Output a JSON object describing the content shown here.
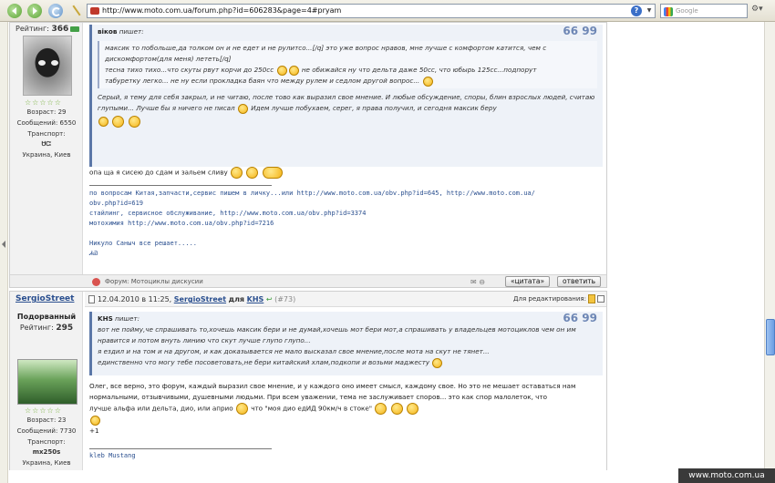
{
  "browser": {
    "url": "http://www.moto.com.ua/forum.php?id=606283&page=4#pryam",
    "search_placeholder": "Google"
  },
  "post1": {
    "side": {
      "rating_label": "Рейтинг:",
      "rating_value": "366",
      "stars": "☆☆☆☆☆",
      "age": "Возраст: 29",
      "messages": "Сообщений: 6550",
      "transport_label": "Транспорт:",
      "transport_value": "ᏌᏨ",
      "location": "Украина, Киев"
    },
    "quote": {
      "author": "вiков",
      "says": "пишет:",
      "inner": "максик то побольше,да толком он и не едет и не рулитсо...[/q] это уже вопрос нравов, мне лучше с комфортом катится, чем с дискомфортом(для меня) лететь[/q]",
      "line2": "тесна тихо тихо...что скуты рвут корчи до 250сс",
      "line2b": "не обижайся ну что дельта даже 50сс, что юбырь 125сс...подпорут",
      "line3": "табуретку легко... не ну если прокладка баян что между рулем и седлом другой вопрос...",
      "line4": "Серый, я тему для себя закрыл, и не читаю, после тово как выразил свое мнение. И любые обсуждение, споры, блин взрослых людей, считаю глупыми... Лучше бы я ничего не писал",
      "line4b": "Идем лучше побухаем, серег, я права получил, и сегодня максик беру"
    },
    "text1": "опа ща я сисею до сдам и зальем сливу",
    "signature": {
      "line1": "по вопросам Китая,запчасти,сервис пишем в личку...или http://www.moto.com.ua/obv.php?id=645, http://www.moto.com.ua/",
      "line2": "obv.php?id=619",
      "line3": "стайлинг, сервисное обслуживание, http://www.moto.com.ua/obv.php?id=3374",
      "line4": "мотохимия http://www.moto.com.ua/obv.php?id=7216",
      "line5": "Никуло Саныч все решает.....",
      "line6": "ᏗᏯ"
    },
    "footer": {
      "forum": "Форум: Мотоциклы дискусии",
      "quote_button": "«цитата»",
      "reply_button": "ответить"
    }
  },
  "post2": {
    "side": {
      "username": "SergioStreet",
      "rank": "Подорванный",
      "rating_label": "Рейтинг:",
      "rating_value": "295",
      "stars": "☆☆☆☆☆",
      "age": "Возраст: 23",
      "messages": "Сообщений: 7730",
      "transport_label": "Транспорт:",
      "transport_value": "mx250s",
      "location": "Украина, Киев"
    },
    "header": {
      "date": "12.04.2010 в 11:25,",
      "author": "SergioStreet",
      "for_word": "для",
      "target": "KHS",
      "postnum": "(#73)",
      "edit_label": "Для редактирования:"
    },
    "quote": {
      "author": "KHS",
      "says": "пишет:",
      "line1": "вот не пойму,че спрашивать то,хочешь максик бери и не думай,хочешь мот бери мот,а спрашивать у владельцев мотоциклов чем он им нравится и потом внуть линию что скут лучше глупо глупо...",
      "line2": "я ездил и на том и на другом, и как доказывается не мало высказал свое мнение,после мота на скут не тянет...",
      "line3": "единственно что могу тебе посоветовать,не бери китайский хлам,подкопи и возьми маджесту"
    },
    "text": "Олег, все верно, это форум, каждый выразил свое мнение, и у каждого оно имеет смысл, каждому свое. Но это не мешает оставаться нам нормальными, отзывчивыми, душевными людьми. При всем уважении, тема не заслуживает споров... это как спор малолеток, что",
    "text2": "лучше альфа или дельта, дио, или априо",
    "text2b": "что \"моя дио едИД 90км/ч в стоке\"",
    "plus": "+1",
    "signature": "kleb Mustang"
  },
  "watermark": "www.moto.com.ua"
}
